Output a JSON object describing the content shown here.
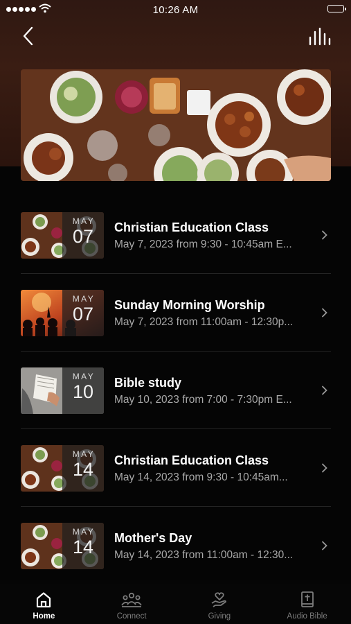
{
  "status_bar": {
    "time": "10:26 AM"
  },
  "header": {
    "back_icon": "chevron-left-icon",
    "action_icon": "equalizer-bars-icon"
  },
  "events": [
    {
      "title": "Christian Education Class",
      "subtitle": "May 7, 2023 from 9:30 - 10:45am E...",
      "month": "MAY",
      "day": "07",
      "thumbnail": "food-table"
    },
    {
      "title": "Sunday Morning Worship",
      "subtitle": "May 7, 2023 from 11:00am - 12:30p...",
      "month": "MAY",
      "day": "07",
      "thumbnail": "worship-stage"
    },
    {
      "title": "Bible study",
      "subtitle": "May 10, 2023 from 7:00 - 7:30pm E...",
      "month": "MAY",
      "day": "10",
      "thumbnail": "open-bible"
    },
    {
      "title": "Christian Education Class",
      "subtitle": "May 14, 2023 from 9:30 - 10:45am...",
      "month": "MAY",
      "day": "14",
      "thumbnail": "food-table"
    },
    {
      "title": "Mother's Day",
      "subtitle": "May 14, 2023 from 11:00am - 12:30...",
      "month": "MAY",
      "day": "14",
      "thumbnail": "food-table"
    }
  ],
  "tabs": [
    {
      "label": "Home",
      "icon": "home-icon",
      "active": true
    },
    {
      "label": "Connect",
      "icon": "people-icon",
      "active": false
    },
    {
      "label": "Giving",
      "icon": "heart-hand-icon",
      "active": false
    },
    {
      "label": "Audio Bible",
      "icon": "bible-cross-icon",
      "active": false
    }
  ],
  "colors": {
    "header_background": "#3a1d13",
    "page_background": "#050505",
    "secondary_text": "#a9a9a9",
    "inactive_tab": "#7c7c7c"
  }
}
